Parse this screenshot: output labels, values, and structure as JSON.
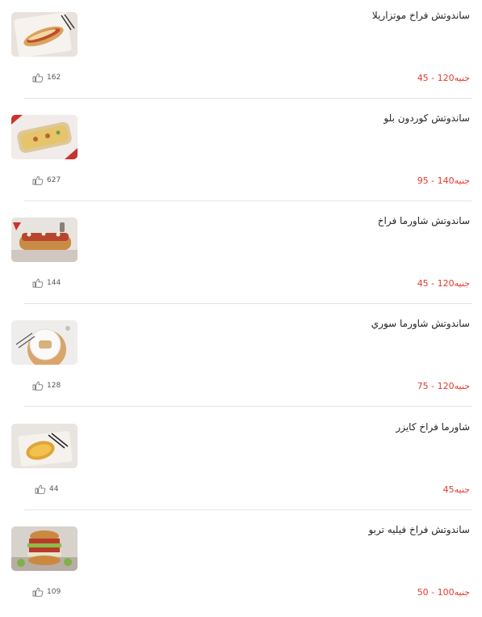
{
  "items": [
    {
      "name": "ساندوتش فراخ موتزاريلا",
      "price": "45 - 120",
      "currency": "جنيه",
      "likes": "162",
      "image": "sandwich-mozzarella"
    },
    {
      "name": "ساندوتش كوردون بلو",
      "price": "95 - 140",
      "currency": "جنيه",
      "likes": "627",
      "image": "sandwich-cordon-bleu"
    },
    {
      "name": "ساندوتش شاورما فراخ",
      "price": "45 - 120",
      "currency": "جنيه",
      "likes": "144",
      "image": "sandwich-shawarma-chicken"
    },
    {
      "name": "ساندوتش شاورما سوري",
      "price": "75 - 120",
      "currency": "جنيه",
      "likes": "128",
      "image": "sandwich-syrian-shawarma"
    },
    {
      "name": "شاورما فراخ كايزر",
      "price": "45",
      "currency": "جنيه",
      "likes": "44",
      "image": "sandwich-kaiser"
    },
    {
      "name": "ساندوتش فراخ فيليه تربو",
      "price": "50 - 100",
      "currency": "جنيه",
      "likes": "109",
      "image": "sandwich-turbo"
    }
  ],
  "colors": {
    "price": "#e23a2c",
    "divider": "#e4e4e4"
  }
}
